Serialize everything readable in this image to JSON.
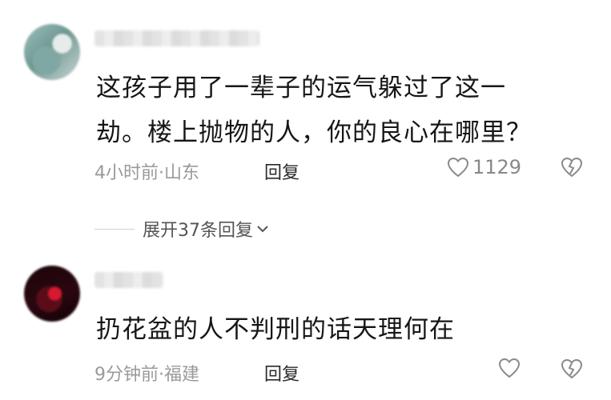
{
  "comments": [
    {
      "text_lines": [
        "这孩子用了一辈子的运气躲过了这一",
        "劫。楼上抛物的人，你的良心在哪里？"
      ],
      "meta": "4小时前·山东",
      "reply_label": "回复",
      "like_count": "1129"
    },
    {
      "text_lines": [
        "扔花盆的人不判刑的话天理何在"
      ],
      "meta": "9分钟前·福建",
      "reply_label": "回复",
      "like_count": ""
    }
  ],
  "expand_replies": {
    "label": "展开37条回复",
    "chevron": "chevron-down-icon"
  },
  "icons": {
    "like": "heart-outline-icon",
    "dislike": "broken-heart-icon"
  },
  "colors": {
    "text": "#161616",
    "meta": "#9a9a9a",
    "icon": "#8a8a8a"
  }
}
